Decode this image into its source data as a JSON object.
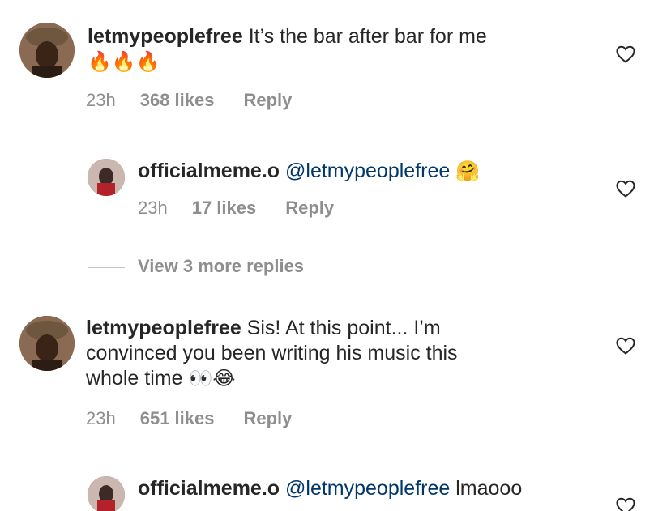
{
  "comments": [
    {
      "username": "letmypeoplefree",
      "text_line1": "It’s the bar after bar for me",
      "emoji_line": "🔥🔥🔥",
      "time": "23h",
      "likes": "368 likes",
      "reply": "Reply"
    },
    {
      "username": "officialmeme.o",
      "mention": "@letmypeoplefree",
      "emoji": "🤗",
      "time": "23h",
      "likes": "17 likes",
      "reply": "Reply"
    },
    {
      "username": "letmypeoplefree",
      "text_line1": "Sis! At this point... I’m",
      "text_line2": "convinced you been writing his music this",
      "text_line3": "whole time",
      "emoji": "👀😂",
      "time": "23h",
      "likes": "651 likes",
      "reply": "Reply"
    },
    {
      "username": "officialmeme.o",
      "mention": "@letmypeoplefree",
      "text": "lmaooo"
    }
  ],
  "view_more": "View 3 more replies",
  "icons": {
    "like": "heart-outline-icon",
    "avatar": "profile-avatar-icon"
  },
  "colors": {
    "text": "#262626",
    "secondary": "#8e8e8e",
    "mention": "#00376b"
  }
}
